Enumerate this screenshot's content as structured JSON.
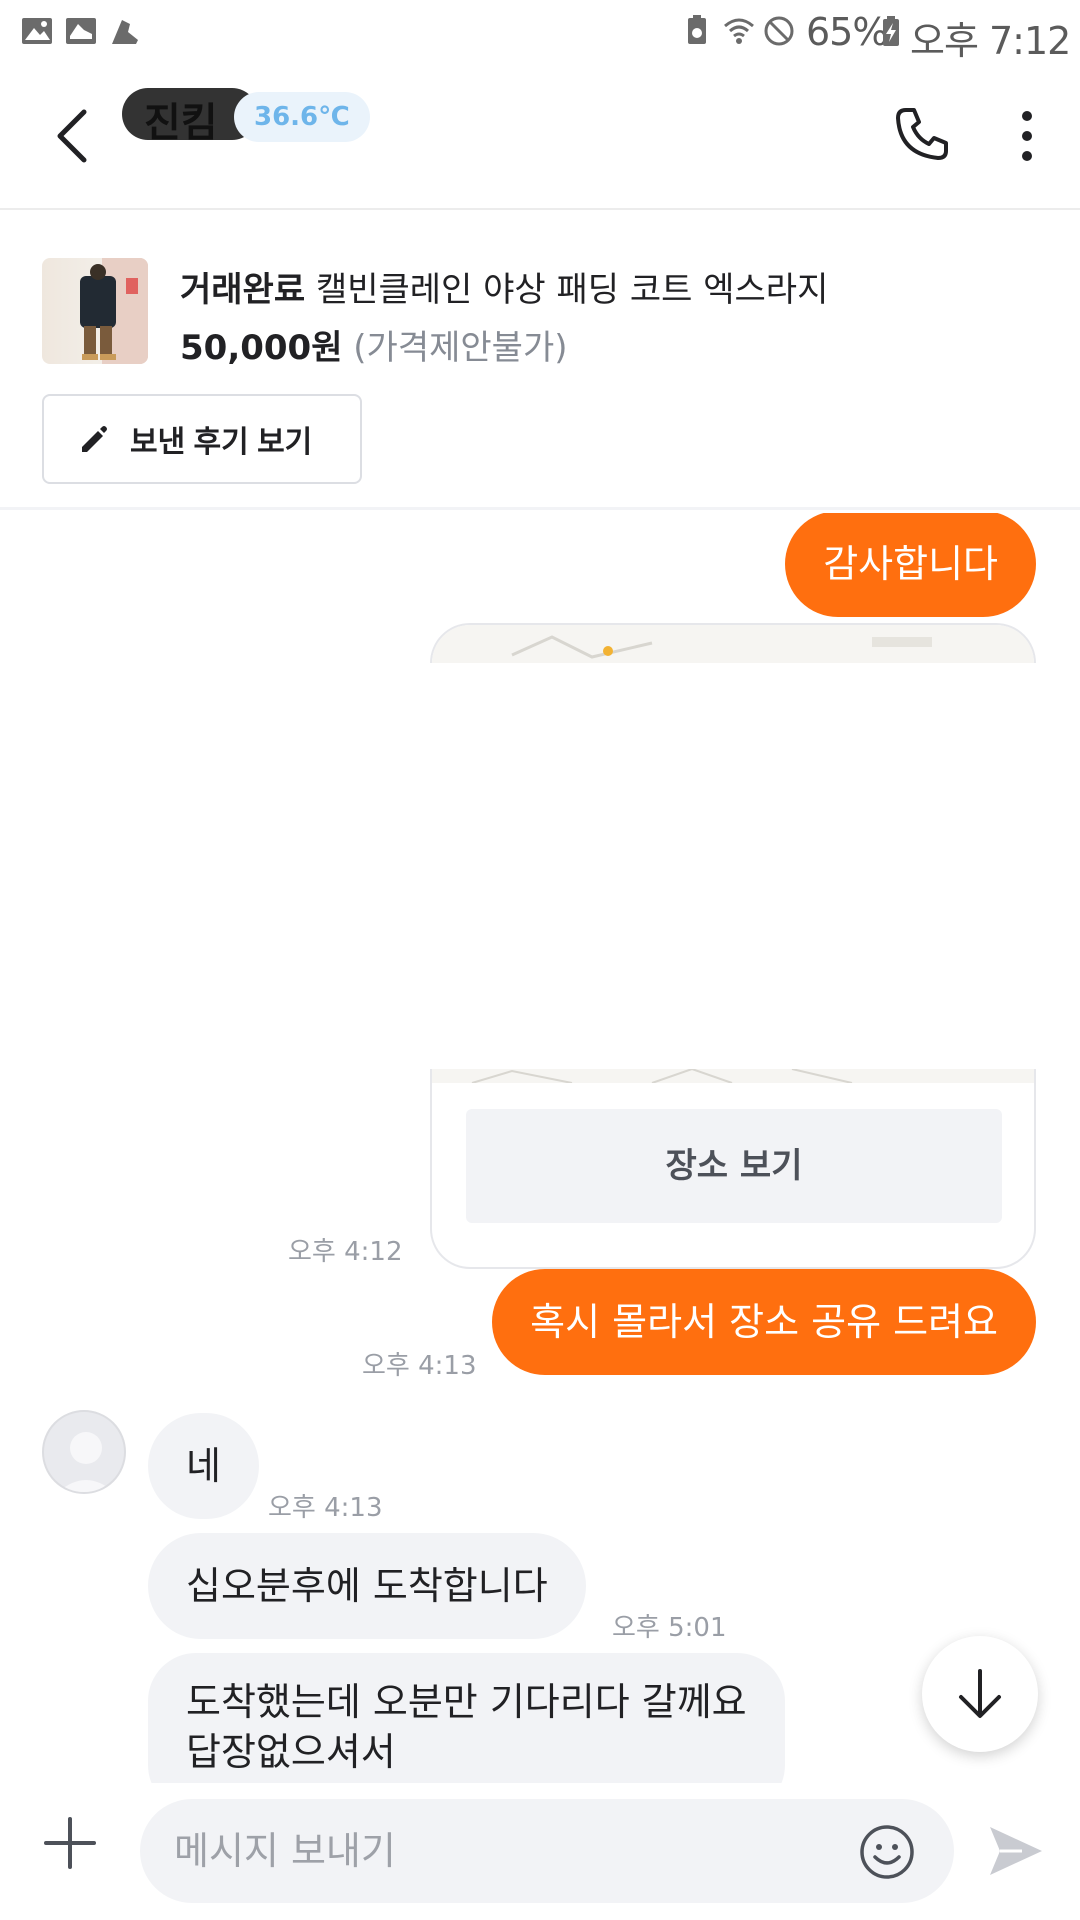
{
  "status_bar": {
    "battery": "65%",
    "time": "오후 7:12"
  },
  "header": {
    "nickname": "진킴",
    "manner_temp": "36.6℃"
  },
  "product": {
    "status": "거래완료",
    "title": "캘빈클레인 야상 패딩 코트 엑스라지",
    "price": "50,000원",
    "price_note": "(가격제안불가)",
    "review_button": "보낸 후기 보기"
  },
  "chat": {
    "messages": [
      {
        "from": "me",
        "text": "감사합니다"
      },
      {
        "from": "me",
        "type": "place",
        "button": "장소 보기",
        "time": "오후 4:12"
      },
      {
        "from": "me",
        "text": "혹시 몰라서 장소 공유 드려요",
        "time": "오후 4:13"
      },
      {
        "from": "other",
        "text": "네",
        "time": "오후 4:13"
      },
      {
        "from": "other",
        "text": "십오분후에 도착합니다",
        "time": "오후 5:01"
      },
      {
        "from": "other",
        "line1": "도착했는데 오분만 기다리다 갈께요",
        "line2": "답장없으셔서"
      }
    ]
  },
  "input": {
    "placeholder": "메시지 보내기"
  },
  "colors": {
    "accent": "#ff6f0f",
    "incoming_bubble": "#f2f3f6",
    "temp_badge": "#6eb5ea"
  },
  "icons": [
    "gallery-icon",
    "shoe-icon",
    "back-icon",
    "phone-icon",
    "more-vertical-icon",
    "pencil-icon",
    "arrow-down-icon",
    "plus-icon",
    "emoji-icon",
    "send-icon"
  ]
}
